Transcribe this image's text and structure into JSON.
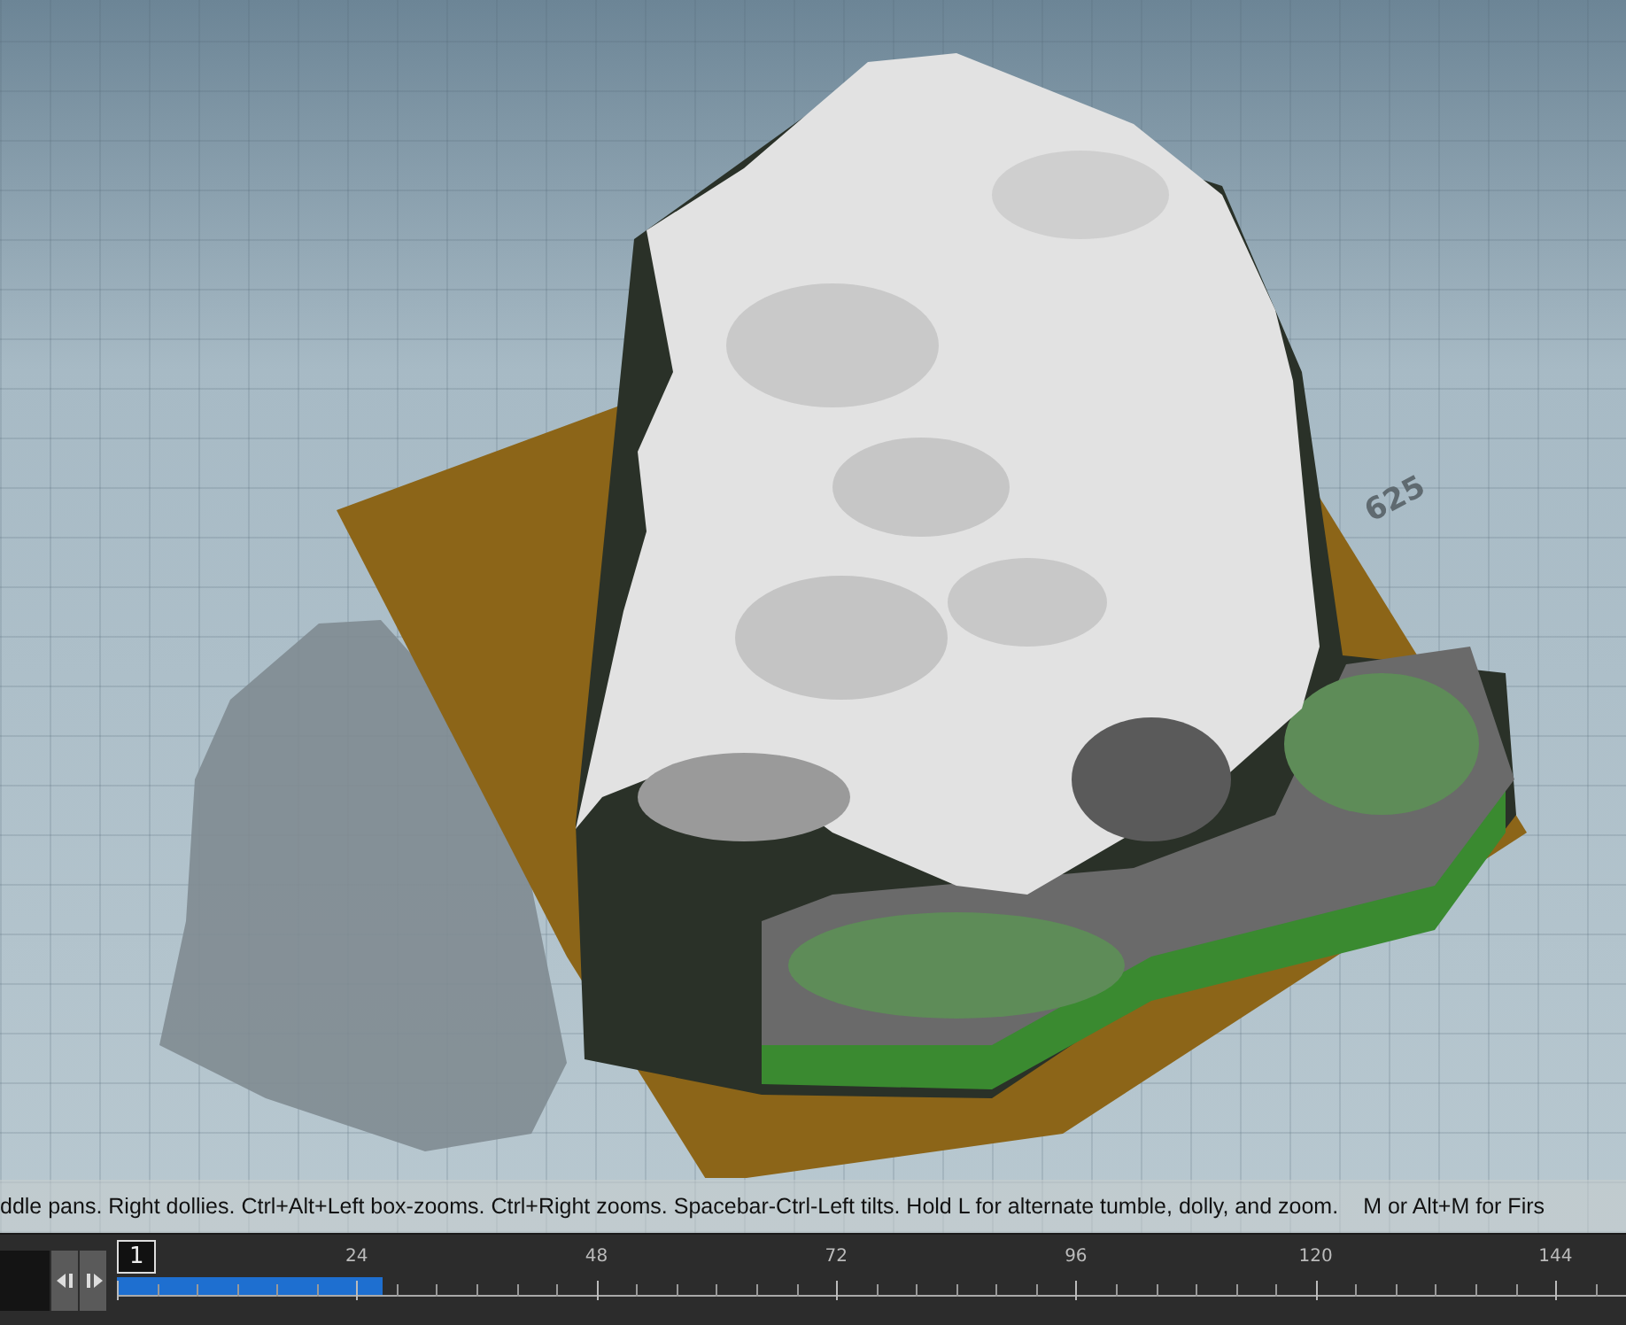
{
  "viewport": {
    "grid_label": "625",
    "hint": "ddle pans. Right dollies. Ctrl+Alt+Left box-zooms. Ctrl+Right zooms. Spacebar-Ctrl-Left tilts. Hold L for alternate tumble, dolly, and zoom.",
    "hint_2": "M or Alt+M for Firs"
  },
  "timeline": {
    "current_frame": "1",
    "cached_range": {
      "level": 0.176
    },
    "tick_labels": [
      "24",
      "48",
      "72",
      "96",
      "120",
      "144"
    ]
  }
}
